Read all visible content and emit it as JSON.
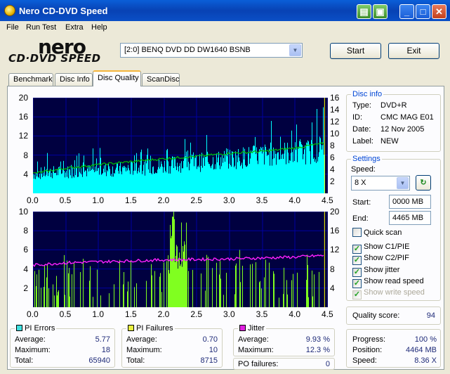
{
  "window": {
    "title": "Nero CD-DVD Speed"
  },
  "menu": [
    "File",
    "Run Test",
    "Extra",
    "Help"
  ],
  "logo": {
    "line1": "nero",
    "line2": "CD·DVD SPEED"
  },
  "drive": {
    "selected": "[2:0]  BENQ DVD DD DW1640 BSNB"
  },
  "buttons": {
    "start": "Start",
    "exit": "Exit"
  },
  "tabs": [
    "Benchmark",
    "Disc Info",
    "Disc Quality",
    "ScanDisc"
  ],
  "active_tab": "Disc Quality",
  "disc_info": {
    "title": "Disc info",
    "type_label": "Type:",
    "type": "DVD+R",
    "id_label": "ID:",
    "id": "CMC MAG E01",
    "date_label": "Date:",
    "date": "12 Nov 2005",
    "label_label": "Label:",
    "label": "NEW"
  },
  "settings": {
    "title": "Settings",
    "speed_label": "Speed:",
    "speed": "8 X",
    "start_label": "Start:",
    "start": "0000 MB",
    "end_label": "End:",
    "end": "4465 MB",
    "quick_scan": "Quick scan",
    "show_c1": "Show C1/PIE",
    "show_c2": "Show C2/PIF",
    "show_jitter": "Show jitter",
    "show_read": "Show read speed",
    "show_write": "Show write speed",
    "checked": {
      "quick_scan": false,
      "show_c1": true,
      "show_c2": true,
      "show_jitter": true,
      "show_read": true,
      "show_write": false
    }
  },
  "quality": {
    "label": "Quality score:",
    "value": "94"
  },
  "progress": {
    "progress_label": "Progress:",
    "progress": "100 %",
    "position_label": "Position:",
    "position": "4464 MB",
    "speed_label": "Speed:",
    "speed": "8.36 X"
  },
  "pi_errors": {
    "title": "PI Errors",
    "color": "#40e0e0",
    "avg_label": "Average:",
    "avg": "5.77",
    "max_label": "Maximum:",
    "max": "18",
    "total_label": "Total:",
    "total": "65940"
  },
  "pi_failures": {
    "title": "PI Failures",
    "color": "#e8f040",
    "avg_label": "Average:",
    "avg": "0.70",
    "max_label": "Maximum:",
    "max": "10",
    "total_label": "Total:",
    "total": "8715"
  },
  "jitter": {
    "title": "Jitter",
    "color": "#e020e0",
    "avg_label": "Average:",
    "avg": "9.93 %",
    "max_label": "Maximum:",
    "max": "12.3 %",
    "po_label": "PO failures:",
    "po": "0"
  },
  "chart_data": [
    {
      "type": "area",
      "title": "PI Errors",
      "x_ticks": [
        "0.0",
        "0.5",
        "1.0",
        "1.5",
        "2.0",
        "2.5",
        "3.0",
        "3.5",
        "4.0",
        "4.5"
      ],
      "y_left_ticks": [
        "20",
        "16",
        "12",
        "8",
        "4"
      ],
      "y_right_ticks": [
        "16",
        "14",
        "12",
        "10",
        "8",
        "6",
        "4",
        "2"
      ],
      "xlim": [
        0,
        4.5
      ],
      "ylim_left": [
        0,
        20
      ],
      "ylim_right": [
        0,
        16
      ],
      "colors": {
        "pi": "#00ffff",
        "read_speed": "#00c000",
        "background": "#000040",
        "grid": "#0000a0"
      },
      "series": [
        {
          "name": "PI Errors",
          "x": [
            0.0,
            0.25,
            0.5,
            0.75,
            1.0,
            1.25,
            1.5,
            1.75,
            2.0,
            2.25,
            2.5,
            2.75,
            3.0,
            3.25,
            3.5,
            3.75,
            4.0,
            4.25,
            4.4
          ],
          "values": [
            5,
            5.5,
            5.6,
            5.8,
            6,
            6.2,
            6.5,
            6.8,
            7.2,
            7.8,
            8,
            8.5,
            9,
            9.5,
            10,
            10.5,
            10.5,
            11,
            12
          ]
        },
        {
          "name": "Read speed",
          "x": [
            0.0,
            0.5,
            1.0,
            1.5,
            2.0,
            2.5,
            3.0,
            3.5,
            4.0,
            4.4
          ],
          "values": [
            3.3,
            4.2,
            4.8,
            5.3,
            5.8,
            6.2,
            6.7,
            7.0,
            7.6,
            8.3
          ]
        }
      ]
    },
    {
      "type": "bar",
      "title": "PI Failures",
      "x_ticks": [
        "0.0",
        "0.5",
        "1.0",
        "1.5",
        "2.0",
        "2.5",
        "3.0",
        "3.5",
        "4.0",
        "4.5"
      ],
      "y_left_ticks": [
        "10",
        "8",
        "6",
        "4",
        "2"
      ],
      "y_right_ticks": [
        "20",
        "16",
        "12",
        "8",
        "4"
      ],
      "xlim": [
        0,
        4.5
      ],
      "ylim_left": [
        0,
        10
      ],
      "ylim_right": [
        0,
        20
      ],
      "colors": {
        "pif": "#80ff20",
        "jitter": "#ff20ff",
        "background": "#000040",
        "grid": "#0000a0"
      },
      "series": [
        {
          "name": "PI Failures",
          "x": [
            0.2,
            0.5,
            0.8,
            1.1,
            1.4,
            1.7,
            2.0,
            2.1,
            2.2,
            2.3,
            2.6,
            2.9,
            3.2,
            3.5,
            3.8,
            4.1,
            4.35
          ],
          "values": [
            4,
            3,
            5,
            4,
            3,
            5,
            6,
            10,
            9,
            6,
            4,
            3,
            4,
            3,
            4,
            3,
            5
          ]
        },
        {
          "name": "Jitter",
          "x": [
            0.0,
            0.5,
            1.0,
            1.5,
            2.0,
            2.5,
            3.0,
            3.5,
            4.0,
            4.4
          ],
          "values": [
            8.8,
            9.3,
            9.5,
            9.7,
            9.9,
            10.0,
            10.1,
            10.3,
            10.5,
            10.8
          ]
        }
      ]
    }
  ]
}
